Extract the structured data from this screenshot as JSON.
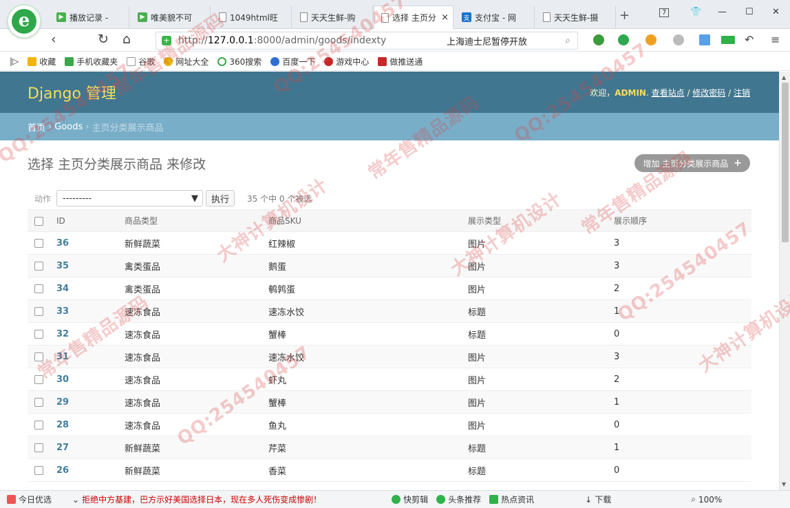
{
  "browser": {
    "tabs": [
      {
        "label": "播放记录 -",
        "icon": "video-icon"
      },
      {
        "label": "唯美貌不可",
        "icon": "video-icon"
      },
      {
        "label": "1049html旺",
        "icon": "doc-icon"
      },
      {
        "label": "天天生鲜-购",
        "icon": "doc-icon"
      },
      {
        "label": "选择 主页分",
        "icon": "doc-icon",
        "close": "×"
      },
      {
        "label": "支付宝 - 网",
        "icon": "alipay-icon"
      },
      {
        "label": "天天生鲜-摄",
        "icon": "doc-icon"
      }
    ],
    "new_tab": "+",
    "badge": "7",
    "address": {
      "scheme": "http://",
      "host": "127.0.0.1",
      "rest": ":8000/admin/goods/indexty",
      "news": "上海迪士尼暂停开放"
    },
    "bookmarks": [
      "收藏",
      "手机收藏夹",
      "谷歌",
      "网址大全",
      "360搜索",
      "百度一下",
      "游戏中心",
      "做推送通"
    ],
    "status": {
      "today": "今日优选",
      "headline": "拒绝中方基建，巴方示好美国选择日本，现在多人死伤变成惨剧！",
      "items": [
        "快剪辑",
        "头条推荐",
        "热点资讯",
        "下载"
      ],
      "zoom": "100%"
    }
  },
  "admin": {
    "brand": "Django 管理",
    "user": {
      "welcome": "欢迎，",
      "name": "ADMIN",
      "sep": ".",
      "view_site": "查看站点",
      "slash1": " / ",
      "change_password": "修改密码",
      "slash2": " / ",
      "logout": "注销"
    },
    "breadcrumbs": {
      "home": "首页",
      "sep1": "›",
      "app": "Goods",
      "sep2": "›",
      "current": "主页分类展示商品"
    },
    "title": "选择 主页分类展示商品 来修改",
    "add_button": "增加 主页分类展示商品",
    "actions": {
      "label": "动作",
      "select_value": "---------",
      "go": "执行",
      "counter": "35 个中 0 个被选"
    },
    "columns": [
      "ID",
      "商品类型",
      "商品SKU",
      "展示类型",
      "展示顺序"
    ],
    "rows": [
      {
        "id": "36",
        "category": "新鲜蔬菜",
        "sku": "红辣椒",
        "display": "图片",
        "order": "3"
      },
      {
        "id": "35",
        "category": "禽类蛋品",
        "sku": "鹅蛋",
        "display": "图片",
        "order": "3"
      },
      {
        "id": "34",
        "category": "禽类蛋品",
        "sku": "鹌鹑蛋",
        "display": "图片",
        "order": "2"
      },
      {
        "id": "33",
        "category": "速冻食品",
        "sku": "速冻水饺",
        "display": "标题",
        "order": "1"
      },
      {
        "id": "32",
        "category": "速冻食品",
        "sku": "蟹棒",
        "display": "标题",
        "order": "0"
      },
      {
        "id": "31",
        "category": "速冻食品",
        "sku": "速冻水饺",
        "display": "图片",
        "order": "3"
      },
      {
        "id": "30",
        "category": "速冻食品",
        "sku": "虾丸",
        "display": "图片",
        "order": "2"
      },
      {
        "id": "29",
        "category": "速冻食品",
        "sku": "蟹棒",
        "display": "图片",
        "order": "1"
      },
      {
        "id": "28",
        "category": "速冻食品",
        "sku": "鱼丸",
        "display": "图片",
        "order": "0"
      },
      {
        "id": "27",
        "category": "新鲜蔬菜",
        "sku": "芹菜",
        "display": "标题",
        "order": "1"
      },
      {
        "id": "26",
        "category": "新鲜蔬菜",
        "sku": "香菜",
        "display": "标题",
        "order": "0"
      }
    ]
  },
  "watermarks": [
    "QQ:254540457",
    "常年售精品源码",
    "大神计算机设计",
    "QQ:254540457",
    "常年售精品源码",
    "大神计算机设计",
    "QQ:254540457",
    "常年售精品源码",
    "QQ:254540457",
    "大神计算机设计",
    "常年售精品源码",
    "QQ:254540457"
  ],
  "colors": {
    "django_header": "#417690",
    "django_breadcrumbs": "#79aec8",
    "brand_yellow": "#f5dd5d",
    "link_blue": "#447e9b",
    "watermark": "#dc4646"
  }
}
